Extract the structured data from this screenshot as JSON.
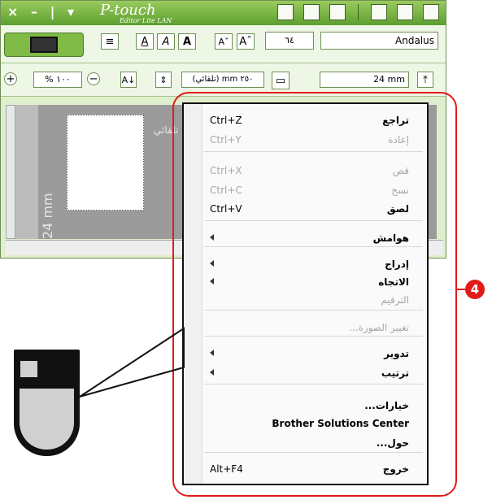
{
  "app": {
    "title_controls": [
      "×",
      "–",
      "|",
      "▾"
    ],
    "logo": "P-touch",
    "logo_sub": "Editor Lite LAN",
    "font_name": "Andalus",
    "font_size": "٦٤",
    "zoom": "% ١٠٠",
    "length": "(تلقائي) mm ٢٥٠",
    "width": "24 mm",
    "canvas_tape": "24 mm",
    "canvas_auto": "تلقائي"
  },
  "menu": {
    "items": [
      {
        "shortcut": "Ctrl+Z",
        "label": "تراجع",
        "disabled": false,
        "submenu": false
      },
      {
        "shortcut": "Ctrl+Y",
        "label": "إعادة",
        "disabled": true,
        "submenu": false
      },
      {
        "shortcut": "Ctrl+X",
        "label": "قص",
        "disabled": true,
        "submenu": false
      },
      {
        "shortcut": "Ctrl+C",
        "label": "نسخ",
        "disabled": true,
        "submenu": false
      },
      {
        "shortcut": "Ctrl+V",
        "label": "لصق",
        "disabled": false,
        "submenu": false
      },
      {
        "shortcut": "",
        "label": "هوامش",
        "disabled": false,
        "submenu": true
      },
      {
        "shortcut": "",
        "label": "إدراج",
        "disabled": false,
        "submenu": true
      },
      {
        "shortcut": "",
        "label": "الاتجاه",
        "disabled": false,
        "submenu": true
      },
      {
        "shortcut": "",
        "label": "الترقيم",
        "disabled": true,
        "submenu": false
      },
      {
        "shortcut": "",
        "label": "تغيير الصورة...",
        "disabled": true,
        "submenu": false
      },
      {
        "shortcut": "",
        "label": "تدوير",
        "disabled": false,
        "submenu": true
      },
      {
        "shortcut": "",
        "label": "ترتيب",
        "disabled": false,
        "submenu": true
      },
      {
        "shortcut": "",
        "label": "خيارات...",
        "disabled": false,
        "submenu": false
      },
      {
        "shortcut": "",
        "label": "Brother Solutions Center",
        "disabled": false,
        "submenu": false
      },
      {
        "shortcut": "",
        "label": "حول...",
        "disabled": false,
        "submenu": false
      },
      {
        "shortcut": "Alt+F4",
        "label": "خروج",
        "disabled": false,
        "submenu": false
      }
    ]
  },
  "callout": {
    "badge": "4",
    "accent": "#e21a1a"
  }
}
